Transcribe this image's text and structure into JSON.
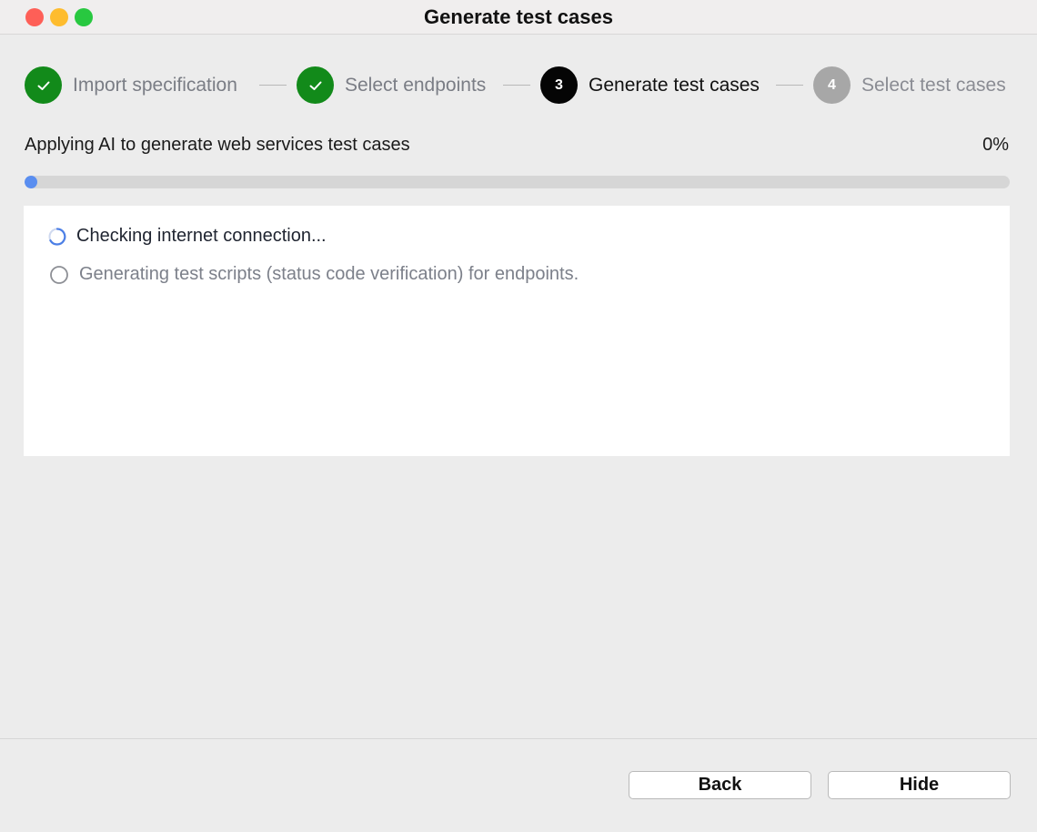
{
  "window": {
    "title": "Generate test cases"
  },
  "stepper": {
    "steps": [
      {
        "label": "Import specification",
        "state": "done",
        "icon": "check-icon"
      },
      {
        "label": "Select endpoints",
        "state": "done",
        "icon": "check-icon"
      },
      {
        "label": "Generate test cases",
        "state": "active",
        "number": "3"
      },
      {
        "label": "Select test cases",
        "state": "pending",
        "number": "4"
      }
    ]
  },
  "progress": {
    "label": "Applying AI to generate web services test cases",
    "percent_text": "0%",
    "value": 0
  },
  "log": {
    "items": [
      {
        "text": "Checking internet connection...",
        "status": "in-progress",
        "icon": "spinner-icon"
      },
      {
        "text": "Generating test scripts (status code verification) for endpoints.",
        "status": "pending",
        "icon": "empty-circle-icon"
      }
    ]
  },
  "footer": {
    "back_label": "Back",
    "hide_label": "Hide"
  },
  "colors": {
    "done": "#128a1a",
    "active": "#050505",
    "pending": "#a7a7a7",
    "progress_fill": "#5a8ef0"
  }
}
